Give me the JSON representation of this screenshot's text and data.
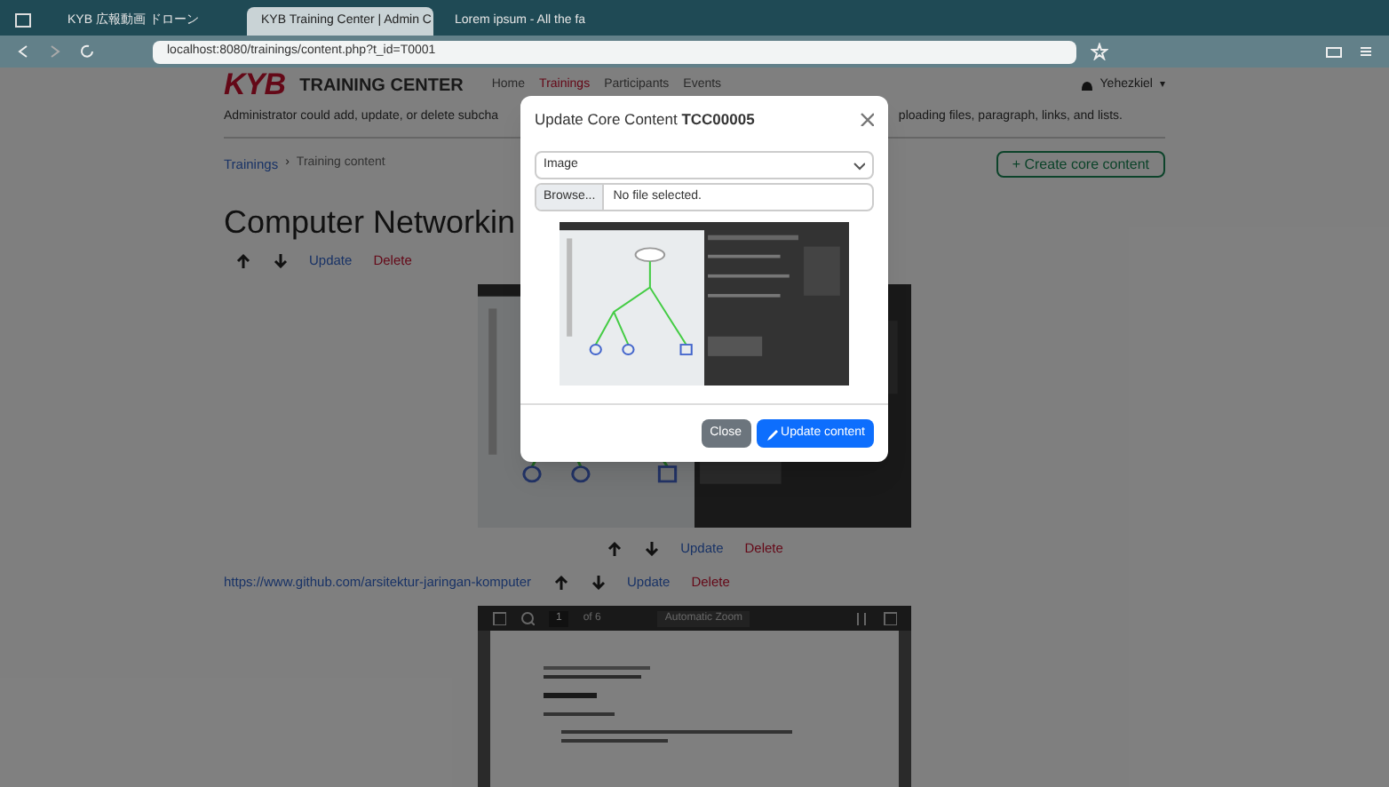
{
  "browser": {
    "tabs": [
      {
        "label": "KYB 広報動画 ドローン",
        "selected": false
      },
      {
        "label": "KYB Training Center | Admin C",
        "selected": true
      },
      {
        "label": "Lorem ipsum - All the fa",
        "selected": false
      }
    ],
    "url": "localhost:8080/trainings/content.php?t_id=T0001"
  },
  "header": {
    "brand": "KYB",
    "title": "TRAINING CENTER",
    "nav": [
      {
        "label": "Home",
        "selected": false
      },
      {
        "label": "Trainings",
        "selected": true
      },
      {
        "label": "Participants",
        "selected": false
      },
      {
        "label": "Events",
        "selected": false
      }
    ],
    "user": "Yehezkiel",
    "user_caret": "▾"
  },
  "description": [
    "Administrator could add, update, or delete subcha",
    "ploading files, paragraph, links, and lists."
  ],
  "breadcrumb": [
    "Trainings",
    "›",
    "Training content"
  ],
  "create_button": "+ Create core content",
  "page_title": "Computer Networkin",
  "actions": {
    "update": "Update",
    "delete": "Delete"
  },
  "contents": [
    {
      "kind": "image",
      "update": "Update",
      "delete": "Delete"
    },
    {
      "kind": "link",
      "text": "https://www.github.com/arsitektur-jaringan-komputer",
      "update": "Update",
      "delete": "Delete"
    },
    {
      "kind": "pdf",
      "page": "1",
      "pages": "of 6",
      "zoom": "Automatic Zoom"
    }
  ],
  "modal": {
    "title": "Update Core Content **TCC00005**",
    "type_select": "Image",
    "browse": "Browse...",
    "file_status": "No file selected.",
    "close": "Close",
    "submit": "Update content"
  }
}
